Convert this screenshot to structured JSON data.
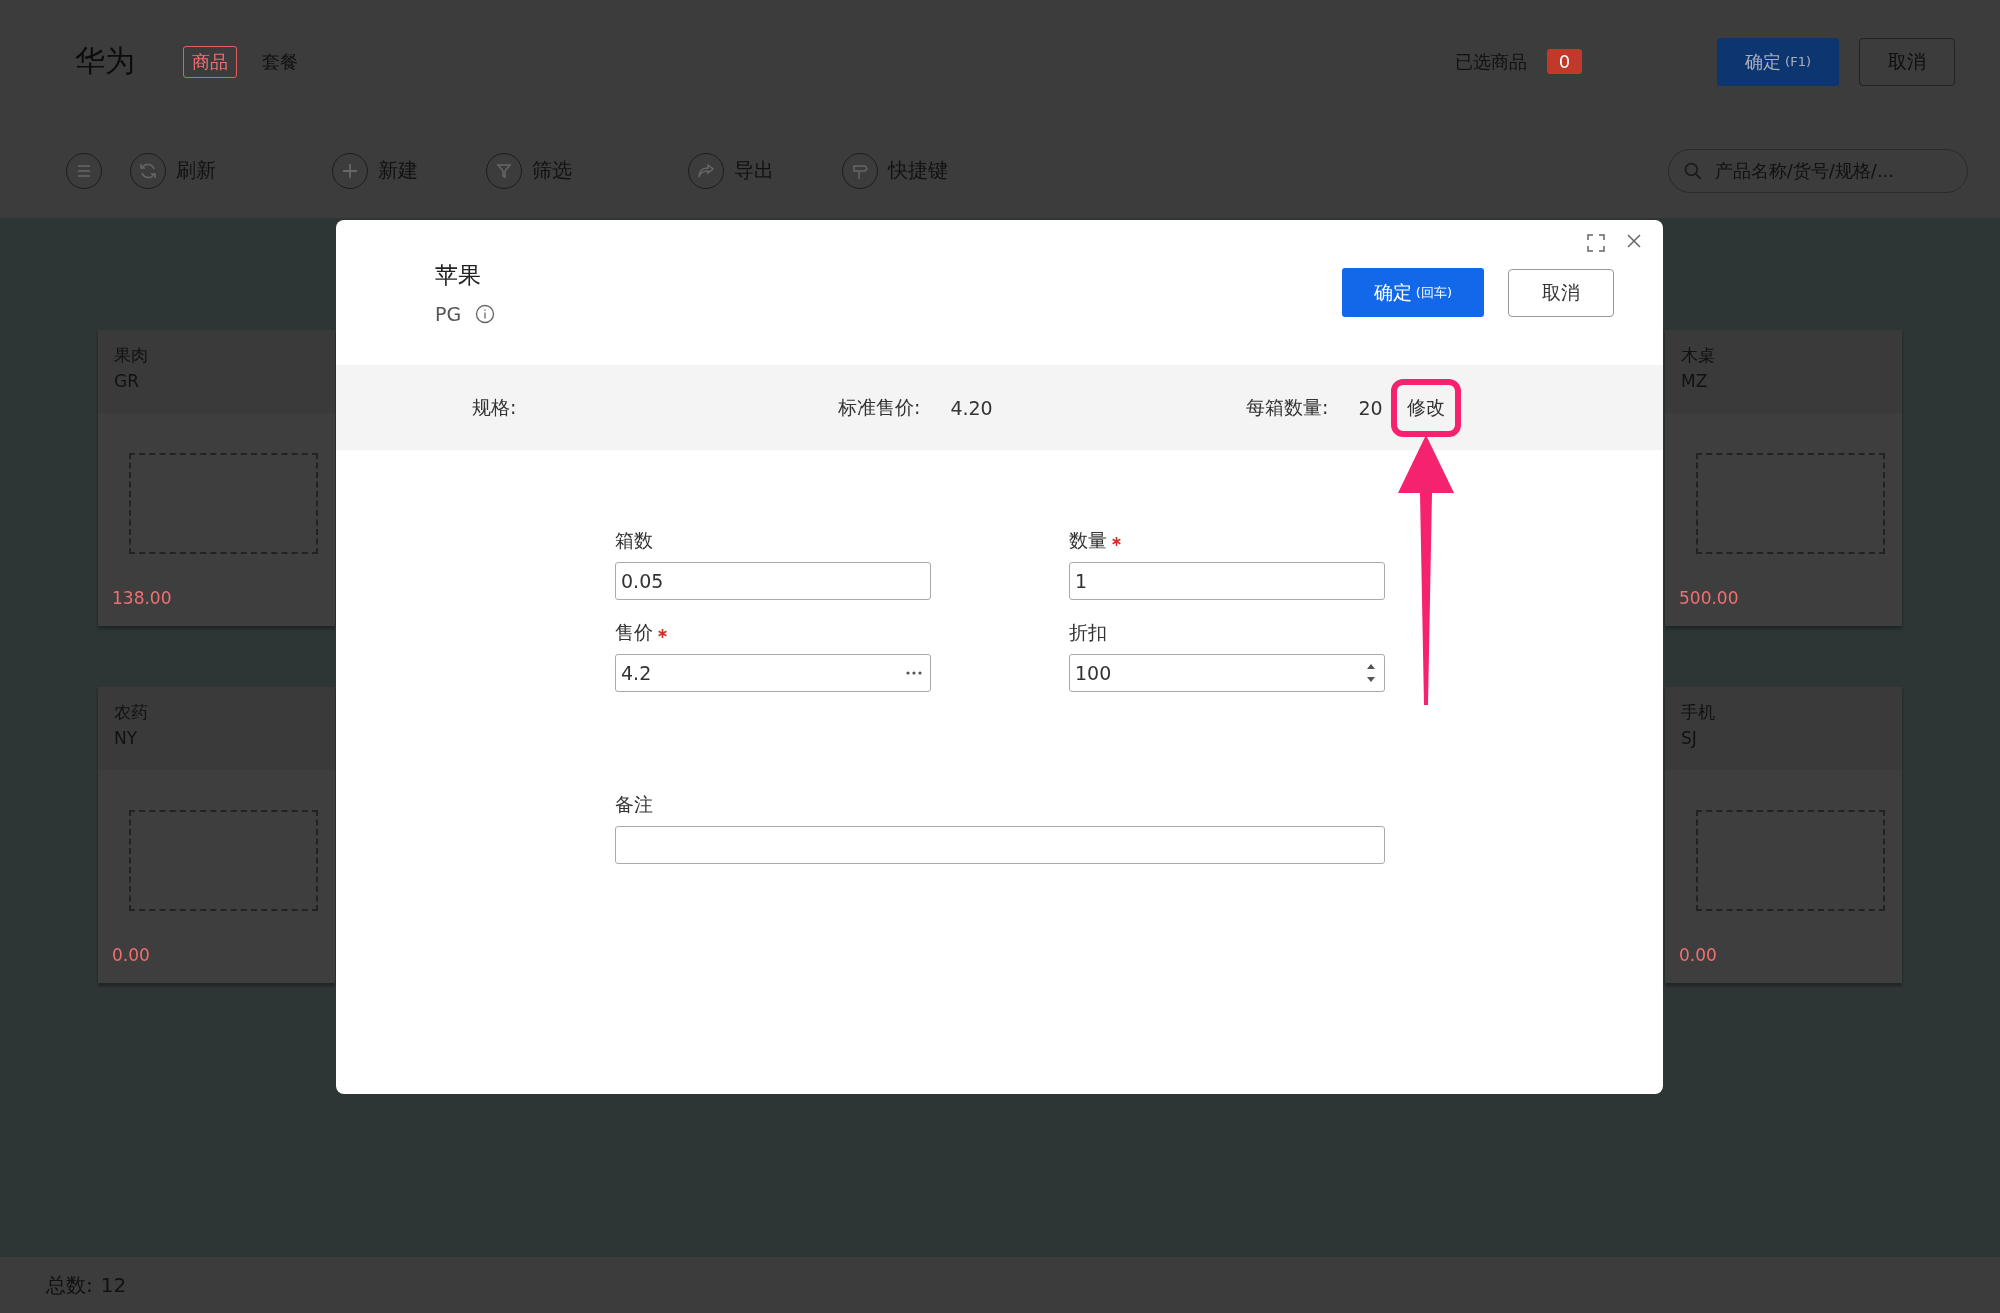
{
  "header": {
    "title": "华为",
    "tabs": [
      {
        "label": "商品",
        "selected": true
      },
      {
        "label": "套餐",
        "selected": false
      }
    ],
    "selected_label": "已选商品",
    "selected_count": "0",
    "confirm_button": {
      "label": "确定",
      "hint": "(F1)"
    },
    "cancel_button": "取消"
  },
  "toolbar": {
    "items": [
      {
        "kind": "refresh",
        "label": "刷新"
      },
      {
        "kind": "new",
        "label": "新建"
      },
      {
        "kind": "filter",
        "label": "筛选"
      },
      {
        "kind": "export",
        "label": "导出"
      },
      {
        "kind": "shortcut",
        "label": "快捷键"
      }
    ],
    "search": {
      "placeholder": "产品名称/货号/规格/..."
    }
  },
  "cards": [
    {
      "name": "果肉",
      "code": "GR",
      "price": "138.00"
    },
    {
      "name": "农药",
      "code": "NY",
      "price": "0.00"
    },
    {
      "name": "木桌",
      "code": "MZ",
      "price": "500.00"
    },
    {
      "name": "手机",
      "code": "SJ",
      "price": "0.00"
    }
  ],
  "modal": {
    "title": "苹果",
    "code": "PG",
    "confirm_button": {
      "label": "确定",
      "hint": "(回车)"
    },
    "cancel_button": "取消",
    "info": {
      "spec_label": "规格:",
      "std_price_label": "标准售价:",
      "std_price": "4.20",
      "per_box_label": "每箱数量:",
      "per_box": "20",
      "edit_button": "修改"
    },
    "fields": [
      {
        "kind": "text",
        "label": "箱数",
        "value": "0.05",
        "required": false
      },
      {
        "kind": "text",
        "label": "数量",
        "value": "1",
        "required": true
      },
      {
        "kind": "picker",
        "label": "售价",
        "value": "4.2",
        "required": true
      },
      {
        "kind": "number",
        "label": "折扣",
        "value": "100",
        "required": false
      }
    ],
    "note": {
      "label": "备注"
    }
  },
  "status_bar": {
    "total_label": "总数:",
    "total": "12"
  }
}
